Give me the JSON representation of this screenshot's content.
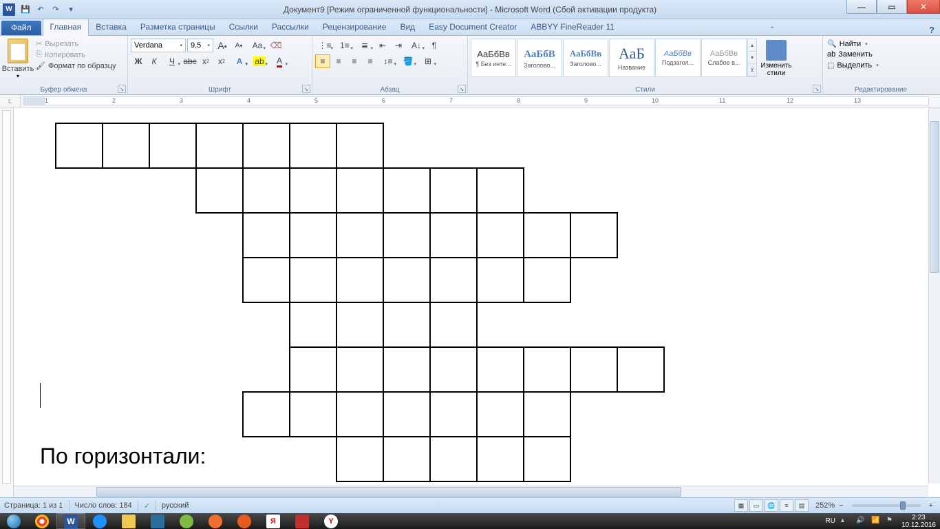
{
  "title": "Документ9 [Режим ограниченной функциональности]  -  Microsoft Word  (Сбой активации продукта)",
  "file_tab": "Файл",
  "tabs": [
    "Главная",
    "Вставка",
    "Разметка страницы",
    "Ссылки",
    "Рассылки",
    "Рецензирование",
    "Вид",
    "Easy Document Creator",
    "ABBYY FineReader 11"
  ],
  "clipboard": {
    "paste": "Вставить",
    "cut": "Вырезать",
    "copy": "Копировать",
    "format_painter": "Формат по образцу",
    "group": "Буфер обмена"
  },
  "font": {
    "name": "Verdana",
    "size": "9,5",
    "group": "Шрифт"
  },
  "paragraph": {
    "group": "Абзац"
  },
  "styles": {
    "group": "Стили",
    "change": "Изменить стили",
    "items": [
      {
        "preview": "АаБбВв",
        "name": "¶ Без инте..."
      },
      {
        "preview": "АаБбВ",
        "name": "Заголово..."
      },
      {
        "preview": "АаБбВв",
        "name": "Заголово..."
      },
      {
        "preview": "АаБ",
        "name": "Название"
      },
      {
        "preview": "АаБбВв",
        "name": "Подзагол..."
      },
      {
        "preview": "АаБбВв",
        "name": "Слабое в..."
      }
    ]
  },
  "editing": {
    "find": "Найти",
    "replace": "Заменить",
    "select": "Выделить",
    "group": "Редактирование"
  },
  "ruler_numbers": [
    "1",
    "2",
    "3",
    "4",
    "5",
    "6",
    "7",
    "8",
    "9",
    "10",
    "11",
    "12",
    "13"
  ],
  "document": {
    "text": "По горизонтали:",
    "crossword_rows": [
      [
        1,
        1,
        1,
        1,
        1,
        1,
        1,
        0,
        0,
        0,
        0,
        0,
        0
      ],
      [
        0,
        0,
        0,
        1,
        1,
        1,
        1,
        1,
        1,
        1,
        0,
        0,
        0
      ],
      [
        0,
        0,
        0,
        0,
        1,
        1,
        1,
        1,
        1,
        1,
        1,
        1,
        0
      ],
      [
        0,
        0,
        0,
        0,
        1,
        1,
        1,
        1,
        1,
        1,
        1,
        0,
        0
      ],
      [
        0,
        0,
        0,
        0,
        0,
        1,
        1,
        1,
        1,
        0,
        0,
        0,
        0
      ],
      [
        0,
        0,
        0,
        0,
        0,
        1,
        1,
        1,
        1,
        1,
        1,
        1,
        1
      ],
      [
        0,
        0,
        0,
        0,
        1,
        1,
        1,
        1,
        1,
        1,
        1,
        0,
        0
      ],
      [
        0,
        0,
        0,
        0,
        0,
        0,
        1,
        1,
        1,
        1,
        1,
        0,
        0
      ]
    ]
  },
  "statusbar": {
    "page": "Страница: 1 из 1",
    "words": "Число слов: 184",
    "lang": "русский",
    "zoom": "252%"
  },
  "tray": {
    "lang": "RU",
    "time": "2:23",
    "date": "10.12.2016"
  }
}
